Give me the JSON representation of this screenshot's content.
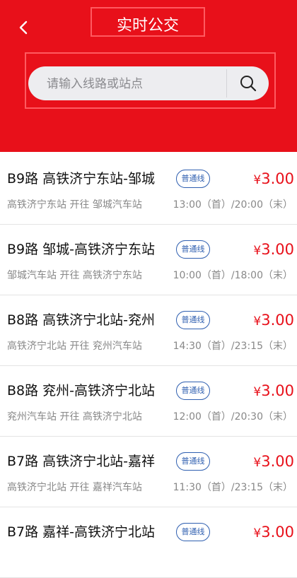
{
  "header": {
    "title": "实时公交",
    "back_icon": "chevron-left-icon",
    "background_color": "#e8101a"
  },
  "search": {
    "placeholder": "请输入线路或站点",
    "value": "",
    "icon": "search-icon"
  },
  "routes": [
    {
      "name": "B9路 高铁济宁东站-邹城",
      "badge": "普通线",
      "currency": "¥",
      "price": "3.00",
      "direction": "高铁济宁东站 开往 邹城汽车站",
      "times": "13:00（首）/20:00（末）"
    },
    {
      "name": "B9路 邹城-高铁济宁东站",
      "badge": "普通线",
      "currency": "¥",
      "price": "3.00",
      "direction": "邹城汽车站 开往 高铁济宁东站",
      "times": "10:00（首）/18:00（末）"
    },
    {
      "name": "B8路 高铁济宁北站-兖州",
      "badge": "普通线",
      "currency": "¥",
      "price": "3.00",
      "direction": "高铁济宁北站 开往 兖州汽车站",
      "times": "14:30（首）/23:15（末）"
    },
    {
      "name": "B8路 兖州-高铁济宁北站",
      "badge": "普通线",
      "currency": "¥",
      "price": "3.00",
      "direction": "兖州汽车站 开往 高铁济宁北站",
      "times": "12:00（首）/20:30（末）"
    },
    {
      "name": "B7路 高铁济宁北站-嘉祥",
      "badge": "普通线",
      "currency": "¥",
      "price": "3.00",
      "direction": "高铁济宁北站 开往 嘉祥汽车站",
      "times": "11:30（首）/23:15（末）"
    },
    {
      "name": "B7路 嘉祥-高铁济宁北站",
      "badge": "普通线",
      "currency": "¥",
      "price": "3.00",
      "direction": "",
      "times": ""
    }
  ],
  "colors": {
    "accent": "#e8101a",
    "badge": "#2f5fb0"
  }
}
